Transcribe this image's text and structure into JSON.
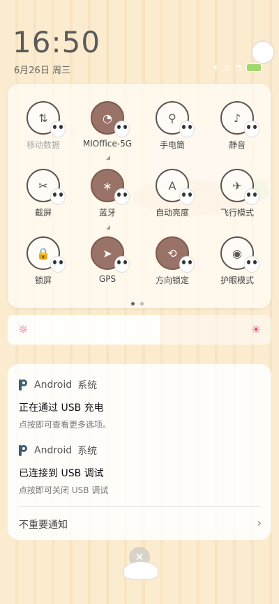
{
  "status": {
    "time": "16:50",
    "date": "6月26日 周三",
    "icons": [
      "bluetooth-icon",
      "alarm-icon",
      "wifi-icon",
      "battery-icon"
    ]
  },
  "quick_settings": {
    "tiles": [
      {
        "label": "移动数据",
        "icon": "mobile-data-icon",
        "glyph": "⇅",
        "on": false,
        "dim": true
      },
      {
        "label": "MIOffice-5G",
        "icon": "wifi-icon",
        "glyph": "◔",
        "on": true,
        "dim": false,
        "sub": "◢"
      },
      {
        "label": "手电筒",
        "icon": "flashlight-icon",
        "glyph": "⚲",
        "on": false,
        "dim": false
      },
      {
        "label": "静音",
        "icon": "bell-icon",
        "glyph": "♪",
        "on": false,
        "dim": false
      },
      {
        "label": "截屏",
        "icon": "screenshot-icon",
        "glyph": "✂",
        "on": false,
        "dim": false
      },
      {
        "label": "蓝牙",
        "icon": "bluetooth-icon",
        "glyph": "∗",
        "on": true,
        "dim": false,
        "sub": "◢"
      },
      {
        "label": "自动亮度",
        "icon": "auto-brightness-icon",
        "glyph": "A",
        "on": false,
        "dim": false
      },
      {
        "label": "飞行模式",
        "icon": "airplane-icon",
        "glyph": "✈",
        "on": false,
        "dim": false
      },
      {
        "label": "锁屏",
        "icon": "lock-icon",
        "glyph": "🔒",
        "on": false,
        "dim": false
      },
      {
        "label": "GPS",
        "icon": "location-icon",
        "glyph": "➤",
        "on": true,
        "dim": false
      },
      {
        "label": "方向锁定",
        "icon": "rotation-lock-icon",
        "glyph": "⟲",
        "on": true,
        "dim": false
      },
      {
        "label": "护眼模式",
        "icon": "eye-icon",
        "glyph": "◉",
        "on": false,
        "dim": false
      }
    ],
    "page_dots": 2,
    "active_page": 1
  },
  "brightness": {
    "level": 0.58
  },
  "notifications": [
    {
      "app": "Android",
      "app_suffix": "系统",
      "title": "正在通过 USB 充电",
      "subtitle": "点按即可查看更多选项。"
    },
    {
      "app": "Android",
      "app_suffix": "系统",
      "title": "已连接到 USB 调试",
      "subtitle": "点按即可关闭 USB 调试"
    }
  ],
  "unimportant_label": "不重要通知"
}
